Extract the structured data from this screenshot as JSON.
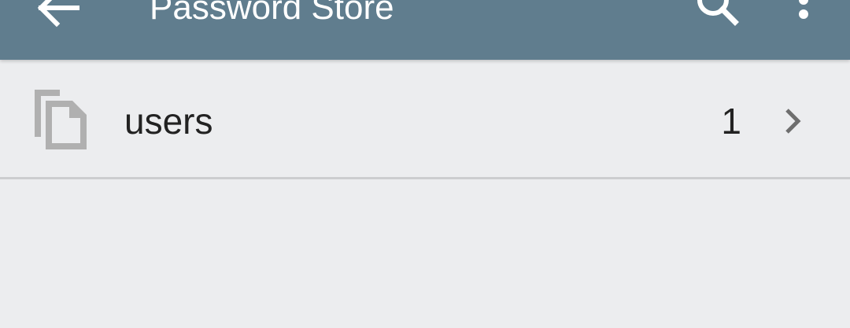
{
  "toolbar": {
    "title": "Password Store",
    "back_icon": "arrow-back-icon",
    "search_icon": "search-icon",
    "overflow_icon": "more-vert-icon",
    "background_color": "#607D8E"
  },
  "list": {
    "items": [
      {
        "label": "users",
        "count": "1",
        "icon": "folder-copy-icon",
        "trailing_icon": "chevron-right-icon"
      }
    ]
  }
}
